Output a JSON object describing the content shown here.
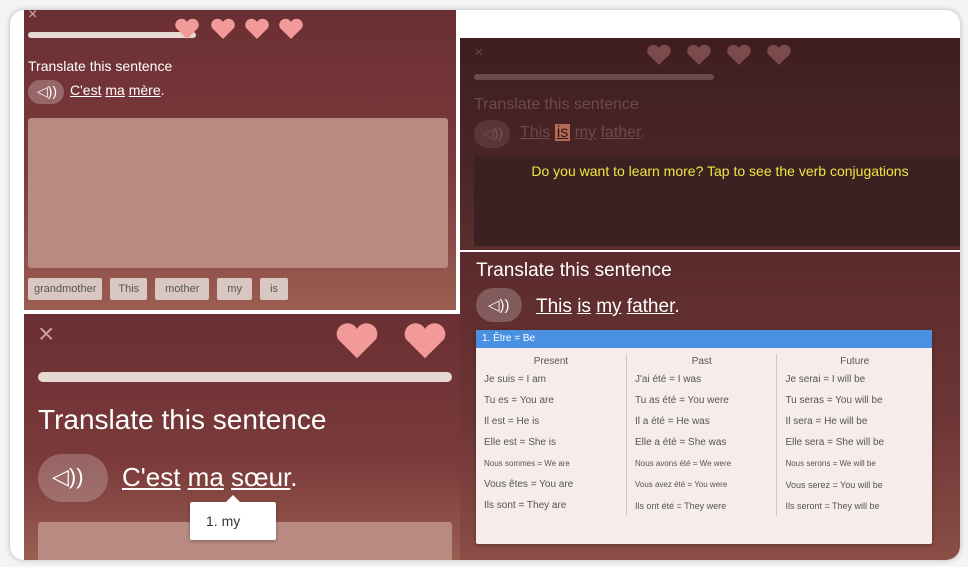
{
  "tl": {
    "title": "Translate this sentence",
    "words": [
      "C'est",
      "ma",
      "mère"
    ],
    "punct": ".",
    "bank": [
      "grandmother",
      "This",
      "mother",
      "my",
      "is"
    ]
  },
  "tr": {
    "title": "Translate this sentence",
    "words": [
      "This",
      "is",
      "my",
      "father"
    ],
    "punct": ".",
    "tip": "Do you want to learn more? Tap to see the verb conjugations"
  },
  "bl": {
    "title": "Translate this sentence",
    "words": [
      "C'est",
      "ma",
      "sœur"
    ],
    "punct": ".",
    "tooltip": "1. my"
  },
  "br": {
    "title": "Translate this sentence",
    "words": [
      "This",
      "is",
      "my",
      "father"
    ],
    "punct": ".",
    "conj": {
      "header": "1. Être = Be",
      "columns": [
        "Present",
        "Past",
        "Future"
      ],
      "rows": [
        [
          "Je suis = I am",
          "J'ai été = I was",
          "Je serai = I will be"
        ],
        [
          "Tu es = You are",
          "Tu as été = You were",
          "Tu seras = You will be"
        ],
        [
          "Il est = He is",
          "Il a été = He was",
          "Il sera = He will be"
        ],
        [
          "Elle est = She is",
          "Elle a été = She was",
          "Elle sera = She will be"
        ],
        [
          "Nous sommes = We are",
          "Nous avons été = We were",
          "Nous serons = We will be"
        ],
        [
          "Vous êtes = You are",
          "Vous avez été = You were",
          "Vous serez = You will be"
        ],
        [
          "Ils sont = They are",
          "Ils ont été = They were",
          "Ils seront = They will be"
        ]
      ]
    }
  },
  "colors": {
    "heart": "#f29a9a",
    "accent": "#4a90e2",
    "tip": "#f2e542"
  }
}
